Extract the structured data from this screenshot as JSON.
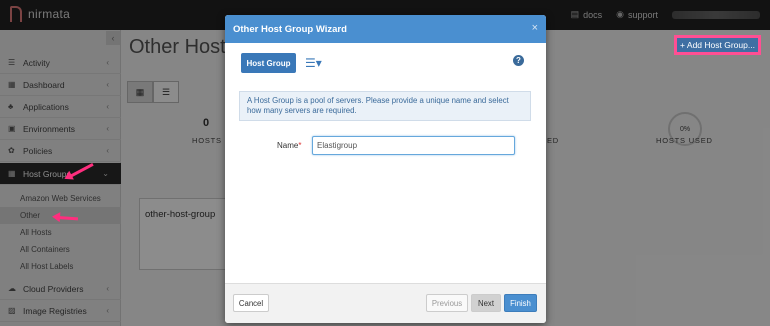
{
  "topbar": {
    "brand": "nirmata",
    "docs_label": "docs",
    "support_label": "support"
  },
  "sidebar": {
    "collapse_glyph": "‹",
    "items": [
      {
        "label": "Activity",
        "icon": "list-icon"
      },
      {
        "label": "Dashboard",
        "icon": "dashboard-icon"
      },
      {
        "label": "Applications",
        "icon": "applications-icon"
      },
      {
        "label": "Environments",
        "icon": "environments-icon"
      },
      {
        "label": "Policies",
        "icon": "policies-icon"
      },
      {
        "label": "Host Groups",
        "icon": "grid-icon",
        "active": true
      },
      {
        "label": "Cloud Providers",
        "icon": "cloud-icon"
      },
      {
        "label": "Image Registries",
        "icon": "image-icon"
      }
    ],
    "host_group_subitems": [
      {
        "label": "Amazon Web Services"
      },
      {
        "label": "Other",
        "selected": true
      },
      {
        "label": "All Hosts"
      },
      {
        "label": "All Containers"
      },
      {
        "label": "All Host Labels"
      }
    ]
  },
  "main": {
    "title": "Other Host G",
    "add_button": "+ Add Host Group...",
    "stats": {
      "hosts_count": "0",
      "hosts_label": "HOSTS",
      "partial_label": "ED",
      "gauge_value": "0%",
      "hosts_used_label": "HOSTS USED"
    },
    "card_title": "other-host-group"
  },
  "modal": {
    "title": "Other Host Group Wizard",
    "close_glyph": "×",
    "tab_label": "Host Group",
    "help_glyph": "?",
    "info_text": "A Host Group is a pool of servers. Please provide a unique name and select how many servers are required.",
    "name_label": "Name",
    "required_mark": "*",
    "name_value": "Elastigroup",
    "buttons": {
      "cancel": "Cancel",
      "previous": "Previous",
      "next": "Next",
      "finish": "Finish"
    }
  },
  "colors": {
    "modal_header": "#4a8fd0",
    "accent_blue": "#3a78b8",
    "highlight_pink": "#ff4f93",
    "sidebar_active": "#2b2b2b"
  }
}
